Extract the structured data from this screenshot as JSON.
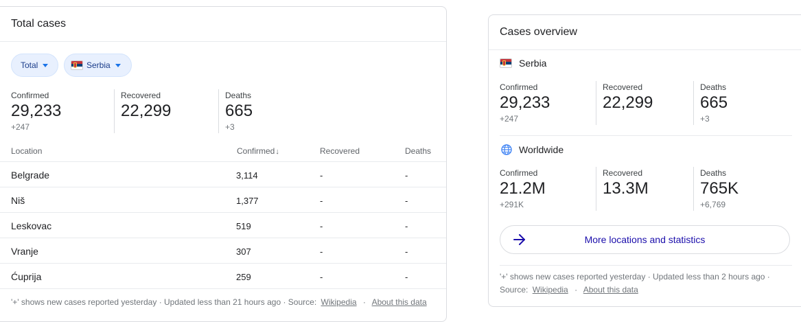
{
  "left": {
    "title": "Total cases",
    "chips": {
      "total": "Total",
      "country": "Serbia"
    },
    "stats": [
      {
        "label": "Confirmed",
        "value": "29,233",
        "delta": "+247"
      },
      {
        "label": "Recovered",
        "value": "22,299",
        "delta": ""
      },
      {
        "label": "Deaths",
        "value": "665",
        "delta": "+3"
      }
    ],
    "table": {
      "headers": {
        "location": "Location",
        "confirmed": "Confirmed",
        "recovered": "Recovered",
        "deaths": "Deaths"
      },
      "rows": [
        {
          "location": "Belgrade",
          "confirmed": "3,114",
          "recovered": "-",
          "deaths": "-"
        },
        {
          "location": "Niš",
          "confirmed": "1,377",
          "recovered": "-",
          "deaths": "-"
        },
        {
          "location": "Leskovac",
          "confirmed": "519",
          "recovered": "-",
          "deaths": "-"
        },
        {
          "location": "Vranje",
          "confirmed": "307",
          "recovered": "-",
          "deaths": "-"
        },
        {
          "location": "Ćuprija",
          "confirmed": "259",
          "recovered": "-",
          "deaths": "-"
        }
      ]
    },
    "footer": {
      "note": "'+' shows new cases reported yesterday · Updated less than 21 hours ago  ·  Source:",
      "source_link": "Wikipedia",
      "sep": "·",
      "about_link": "About this data"
    }
  },
  "right": {
    "title": "Cases overview",
    "serbia": {
      "heading": "Serbia",
      "stats": [
        {
          "label": "Confirmed",
          "value": "29,233",
          "delta": "+247"
        },
        {
          "label": "Recovered",
          "value": "22,299",
          "delta": ""
        },
        {
          "label": "Deaths",
          "value": "665",
          "delta": "+3"
        }
      ]
    },
    "worldwide": {
      "heading": "Worldwide",
      "stats": [
        {
          "label": "Confirmed",
          "value": "21.2M",
          "delta": "+291K"
        },
        {
          "label": "Recovered",
          "value": "13.3M",
          "delta": ""
        },
        {
          "label": "Deaths",
          "value": "765K",
          "delta": "+6,769"
        }
      ]
    },
    "more_button": "More locations and statistics",
    "footer": {
      "line1": "'+' shows new cases reported yesterday · Updated less than 2 hours ago  ·",
      "source_label": "Source:",
      "source_link": "Wikipedia",
      "sep": "·",
      "about_link": "About this data"
    }
  },
  "colors": {
    "chip_bg": "#e8f0fe",
    "accent": "#1a73e8",
    "link": "#1a0dab",
    "muted": "#70757a"
  }
}
